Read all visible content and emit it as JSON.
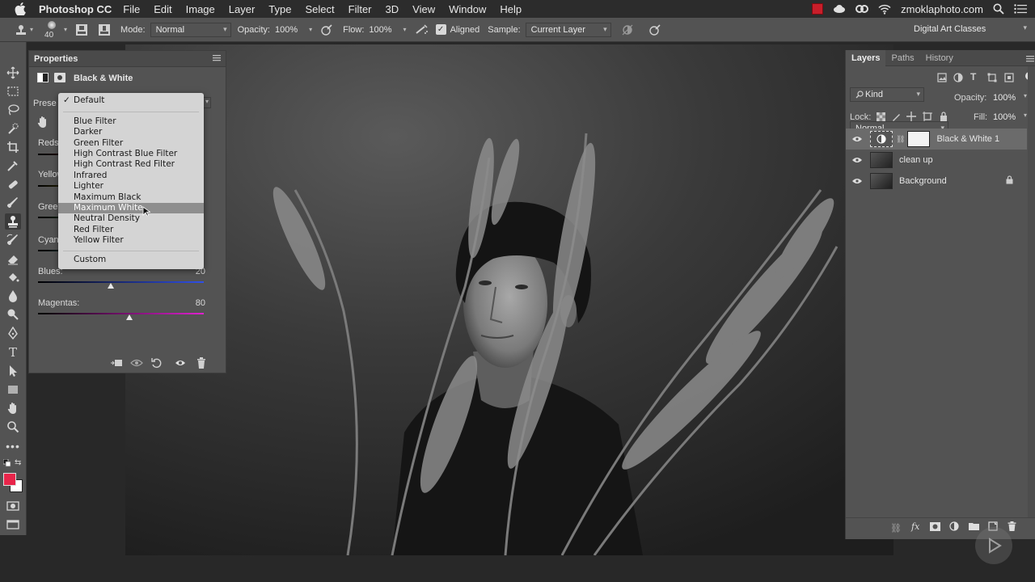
{
  "menubar": {
    "app_name": "Photoshop CC",
    "items": [
      "File",
      "Edit",
      "Image",
      "Layer",
      "Type",
      "Select",
      "Filter",
      "3D",
      "View",
      "Window",
      "Help"
    ],
    "site": "zmoklaphoto.com",
    "icons": [
      "apple-icon",
      "red-square-icon",
      "cloud-icon",
      "creative-cloud-icon",
      "wifi-icon",
      "spotlight-search-icon",
      "notification-list-icon"
    ]
  },
  "options_bar": {
    "brush_size": "40",
    "mode_label": "Mode:",
    "mode_value": "Normal",
    "opacity_label": "Opacity:",
    "opacity_value": "100%",
    "flow_label": "Flow:",
    "flow_value": "100%",
    "aligned_label": "Aligned",
    "aligned_checked": true,
    "sample_label": "Sample:",
    "sample_value": "Current Layer",
    "workspace": "Digital Art Classes"
  },
  "properties": {
    "title": "Properties",
    "adjustment": "Black & White",
    "preset_label_partial": "Prese",
    "sliders": [
      {
        "label": "Reds",
        "value": ""
      },
      {
        "label": "Yellow",
        "value": ""
      },
      {
        "label": "Green",
        "value": ""
      },
      {
        "label": "Cyan",
        "value": ""
      },
      {
        "label": "Blues:",
        "value": "20",
        "position": 0.44
      },
      {
        "label": "Magentas:",
        "value": "80",
        "position": 0.55
      }
    ],
    "preset_menu": {
      "items": [
        {
          "label": "Default",
          "checked": true
        },
        {
          "label": "Blue Filter"
        },
        {
          "label": "Darker"
        },
        {
          "label": "Green Filter"
        },
        {
          "label": "High Contrast Blue Filter"
        },
        {
          "label": "High Contrast Red Filter"
        },
        {
          "label": "Infrared"
        },
        {
          "label": "Lighter"
        },
        {
          "label": "Maximum Black"
        },
        {
          "label": "Maximum White",
          "highlighted": true
        },
        {
          "label": "Neutral Density"
        },
        {
          "label": "Red Filter"
        },
        {
          "label": "Yellow Filter"
        },
        {
          "label": "Custom"
        }
      ]
    }
  },
  "layers_panel": {
    "tabs": [
      "Layers",
      "Paths",
      "History"
    ],
    "active_tab": "Layers",
    "filter_kind": "Kind",
    "blend_mode": "Normal",
    "opacity_label": "Opacity:",
    "opacity_value": "100%",
    "lock_label": "Lock:",
    "fill_label": "Fill:",
    "fill_value": "100%",
    "layers": [
      {
        "name": "Black & White 1",
        "selected": true,
        "type": "adjustment"
      },
      {
        "name": "clean up",
        "selected": false,
        "type": "pixel"
      },
      {
        "name": "Background",
        "selected": false,
        "type": "pixel",
        "locked": true
      }
    ]
  },
  "colors": {
    "panel": "#535353",
    "dark": "#282828",
    "foreground_swatch": "#e8254a",
    "background_swatch": "#ffffff"
  }
}
